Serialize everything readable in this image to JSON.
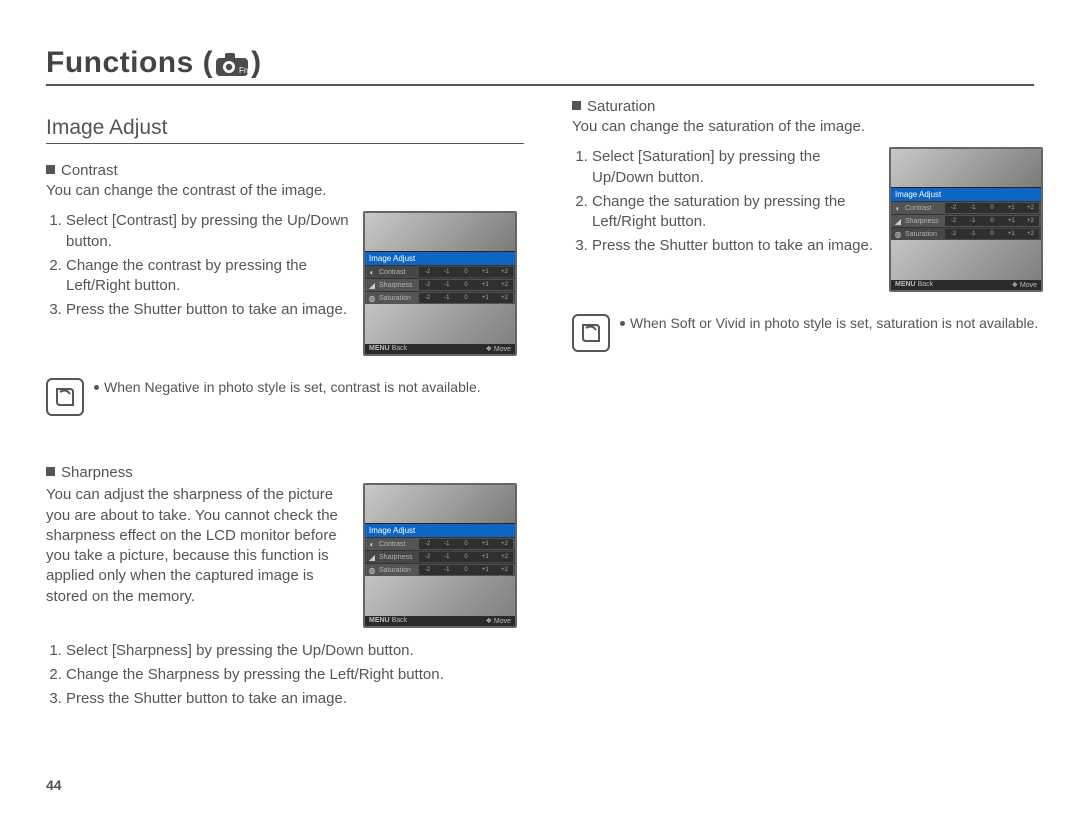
{
  "page_number": "44",
  "title_prefix": "Functions (",
  "title_suffix": " )",
  "subheading": "Image Adjust",
  "lcd": {
    "menu_title": "Image Adjust",
    "rows": [
      "Contrast",
      "Sharpness",
      "Saturation"
    ],
    "ticks": [
      "-2",
      "-1",
      "0",
      "+1",
      "+2"
    ],
    "back": "Back",
    "move": "Move",
    "back_key": "MENU",
    "move_key": "❖"
  },
  "contrast": {
    "heading": "Contrast",
    "desc": "You can change the contrast of the image.",
    "steps": [
      "Select [Contrast] by pressing the Up/Down button.",
      "Change the contrast by pressing the Left/Right button.",
      "Press the Shutter button to take an image."
    ],
    "note": "When Negative in photo style is set, contrast is not available."
  },
  "sharpness": {
    "heading": "Sharpness",
    "desc": "You can adjust the sharpness of the picture you are about to take. You cannot check the sharpness effect on the LCD monitor before you take a picture, because this function is applied only when the captured image is stored on the memory.",
    "steps": [
      "Select [Sharpness] by pressing the Up/Down button.",
      "Change the Sharpness by pressing the Left/Right button.",
      "Press the Shutter button to take an image."
    ]
  },
  "saturation": {
    "heading": "Saturation",
    "desc": "You can change the saturation of the image.",
    "steps": [
      "Select [Saturation] by pressing the Up/Down button.",
      "Change the saturation by pressing the Left/Right button.",
      "Press the Shutter button to take an image."
    ],
    "note": "When Soft or Vivid in photo style is set, saturation is not available."
  }
}
